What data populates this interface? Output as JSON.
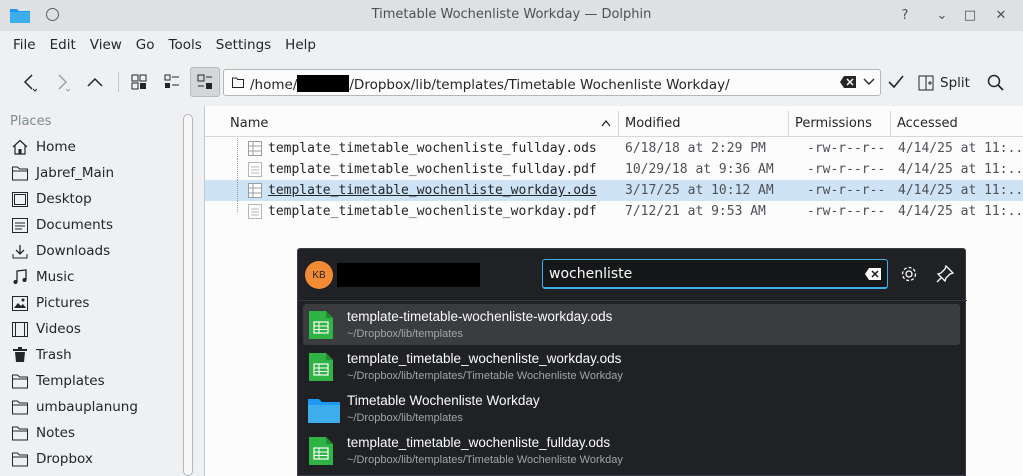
{
  "window": {
    "title": "Timetable Wochenliste Workday — Dolphin",
    "help_glyph": "?",
    "minimize_glyph": "⌄",
    "maximize_glyph": "□",
    "close_glyph": "✕"
  },
  "menu": [
    "File",
    "Edit",
    "View",
    "Go",
    "Tools",
    "Settings",
    "Help"
  ],
  "toolbar": {
    "path_prefix": "/home/",
    "path_suffix": "/Dropbox/lib/templates/Timetable Wochenliste Workday/",
    "split_label": "Split"
  },
  "places": {
    "header": "Places",
    "items": [
      {
        "label": "Home",
        "icon": "home-icon"
      },
      {
        "label": "Jabref_Main",
        "icon": "folder-icon"
      },
      {
        "label": "Desktop",
        "icon": "desktop-icon"
      },
      {
        "label": "Documents",
        "icon": "documents-icon"
      },
      {
        "label": "Downloads",
        "icon": "downloads-icon"
      },
      {
        "label": "Music",
        "icon": "music-icon"
      },
      {
        "label": "Pictures",
        "icon": "pictures-icon"
      },
      {
        "label": "Videos",
        "icon": "videos-icon"
      },
      {
        "label": "Trash",
        "icon": "trash-icon"
      },
      {
        "label": "Templates",
        "icon": "folder-icon"
      },
      {
        "label": "umbauplanung",
        "icon": "folder-icon"
      },
      {
        "label": "Notes",
        "icon": "folder-icon"
      },
      {
        "label": "Dropbox",
        "icon": "folder-icon"
      }
    ]
  },
  "files": {
    "columns": [
      "Name",
      "Modified",
      "Permissions",
      "Accessed"
    ],
    "rows": [
      {
        "name": "template_timetable_wochenliste_fullday.ods",
        "modified": "6/18/18 at 2:29 PM",
        "permissions": "-rw-r--r--",
        "accessed": "4/14/25 at 11:..."
      },
      {
        "name": "template_timetable_wochenliste_fullday.pdf",
        "modified": "10/29/18 at 9:36 AM",
        "permissions": "-rw-r--r--",
        "accessed": "4/14/25 at 11:..."
      },
      {
        "name": "template_timetable_wochenliste_workday.ods",
        "modified": "3/17/25 at 10:12 AM",
        "permissions": "-rw-r--r--",
        "accessed": "4/14/25 at 11:..."
      },
      {
        "name": "template_timetable_wochenliste_workday.pdf",
        "modified": "7/12/21 at 9:53 AM",
        "permissions": "-rw-r--r--",
        "accessed": "4/14/25 at 11:..."
      }
    ]
  },
  "krunner": {
    "avatar_initials": "KB",
    "query": "wochenliste",
    "results": [
      {
        "title": "template-timetable-wochenliste-workday.ods",
        "subtitle": "~/Dropbox/lib/templates",
        "icon": "spreadsheet-icon"
      },
      {
        "title": "template_timetable_wochenliste_workday.ods",
        "subtitle": "~/Dropbox/lib/templates/Timetable Wochenliste Workday",
        "icon": "spreadsheet-icon"
      },
      {
        "title": "Timetable Wochenliste Workday",
        "subtitle": "~/Dropbox/lib/templates",
        "icon": "folder-icon"
      },
      {
        "title": "template_timetable_wochenliste_fullday.ods",
        "subtitle": "~/Dropbox/lib/templates/Timetable Wochenliste Workday",
        "icon": "spreadsheet-icon"
      }
    ]
  },
  "colors": {
    "accent": "#3daee9",
    "selection": "#cfe3f7",
    "krunner_bg": "#1f2124",
    "avatar": "#f38b35",
    "spreadsheet_green": "#2fb344"
  }
}
